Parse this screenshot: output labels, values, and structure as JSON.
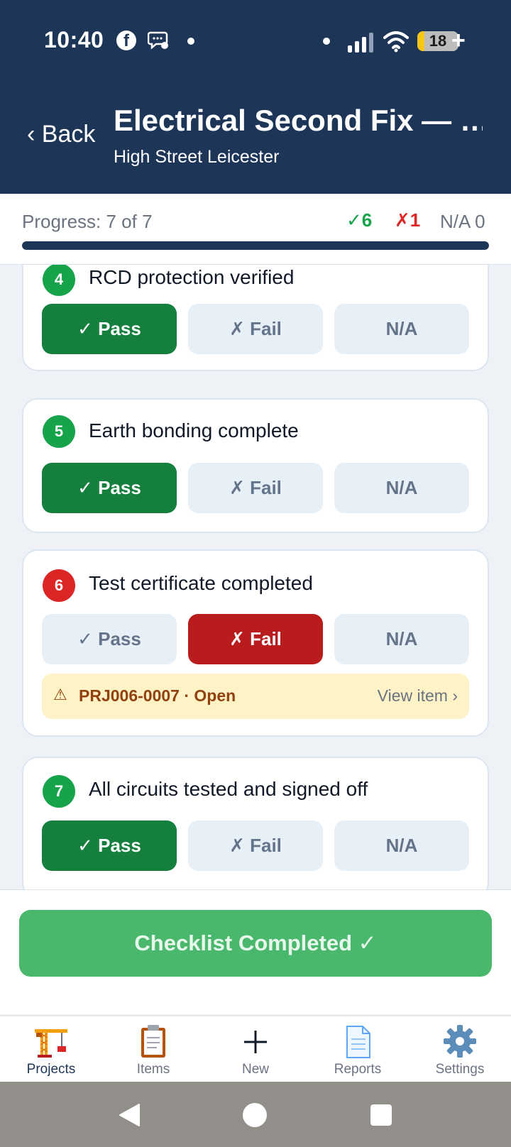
{
  "status_bar": {
    "time": "10:40",
    "battery_level": "18",
    "battery_fraction": 0.18,
    "icons": [
      "facebook-icon",
      "messenger-icon",
      "signal-icon",
      "wifi-icon",
      "battery-icon"
    ]
  },
  "header": {
    "back_label": "‹ Back",
    "title": "Electrical Second Fix — …",
    "subtitle": "High Street Leicester",
    "background_color": "#1d3557"
  },
  "progress": {
    "label": "Progress: 7 of 7",
    "completed": 7,
    "total": 7,
    "pass_count": "✓6",
    "fail_count": "✗1",
    "na_count": "N/A 0"
  },
  "options": {
    "pass_label": "✓ Pass",
    "fail_label": "✗ Fail",
    "na_label": "N/A"
  },
  "checklist": [
    {
      "number": "4",
      "title": "RCD protection verified",
      "state": "pass"
    },
    {
      "number": "5",
      "title": "Earth bonding complete",
      "state": "pass"
    },
    {
      "number": "6",
      "title": "Test certificate completed",
      "state": "fail",
      "issue": {
        "text": "PRJ006-0007  ·  Open",
        "link": "View item ›"
      }
    },
    {
      "number": "7",
      "title": "All circuits tested and signed off",
      "state": "pass"
    }
  ],
  "footer": {
    "complete_label": "Checklist Completed ✓",
    "complete_color": "#4ab86c"
  },
  "bottom_nav": [
    {
      "label": "Projects",
      "icon": "crane-icon",
      "active": true
    },
    {
      "label": "Items",
      "icon": "clipboard-icon",
      "active": false
    },
    {
      "label": "New",
      "icon": "plus-icon",
      "active": false
    },
    {
      "label": "Reports",
      "icon": "document-icon",
      "active": false
    },
    {
      "label": "Settings",
      "icon": "gear-icon",
      "active": false
    }
  ],
  "colors": {
    "pass": "#15803d",
    "fail": "#b91c1c",
    "idle": "#e8f0f7",
    "warning_bg": "#fef3c7"
  }
}
